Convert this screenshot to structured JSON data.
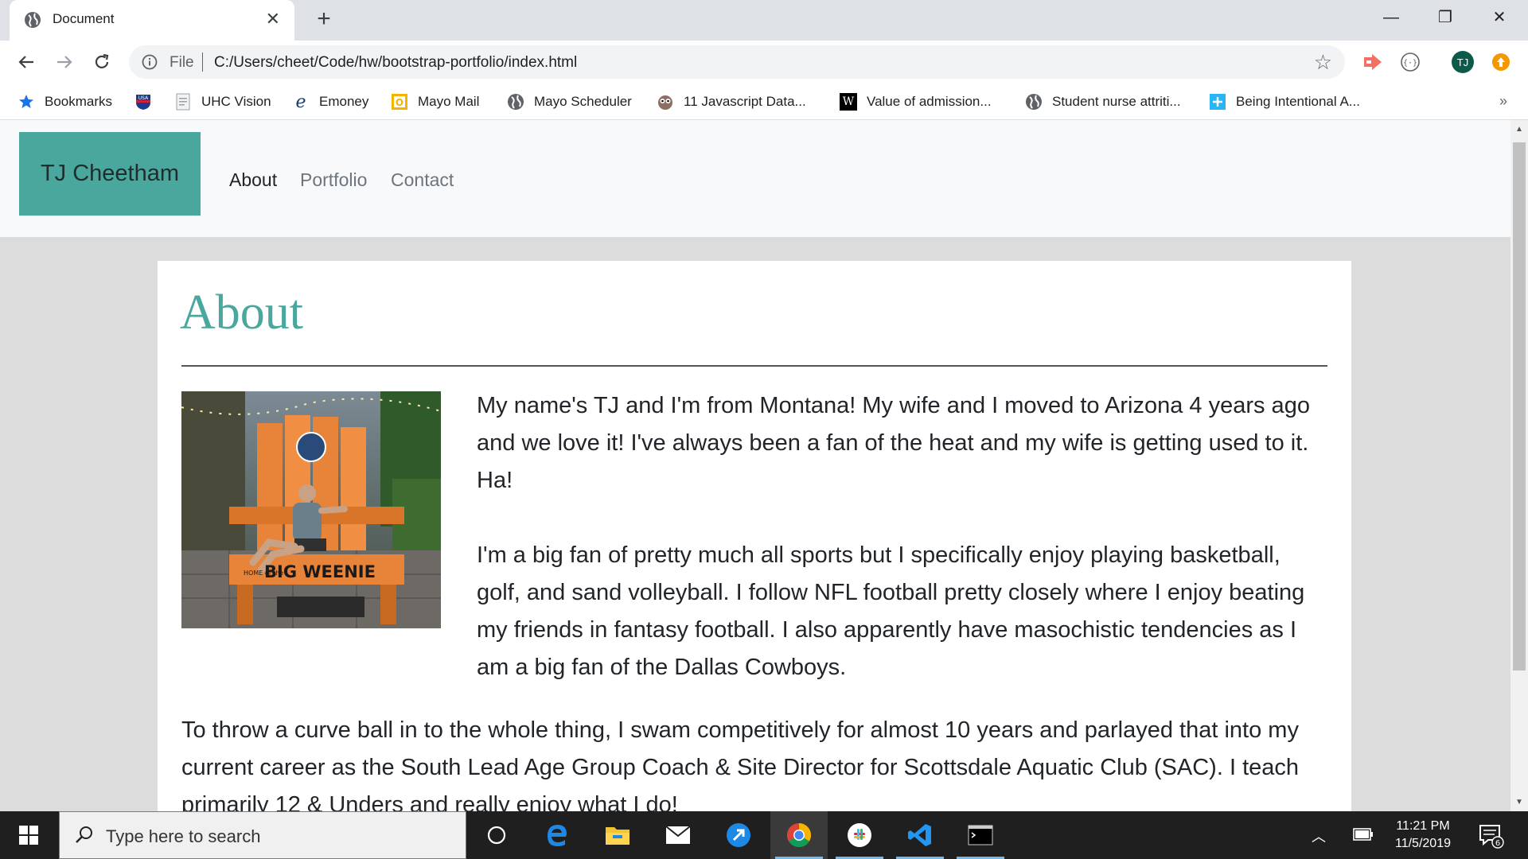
{
  "browser": {
    "tab_title": "Document",
    "url_scheme": "File",
    "url": "C:/Users/cheet/Code/hw/bootstrap-portfolio/index.html",
    "avatar_initials": "TJ",
    "bookmarks": [
      {
        "label": "Bookmarks",
        "icon": "star-icon"
      },
      {
        "label": "",
        "icon": "usa-flag-icon"
      },
      {
        "label": "UHC Vision",
        "icon": "document-icon"
      },
      {
        "label": "Emoney",
        "icon": "e-logo-icon"
      },
      {
        "label": "Mayo Mail",
        "icon": "outlook-icon"
      },
      {
        "label": "Mayo Scheduler",
        "icon": "globe-icon"
      },
      {
        "label": "11 Javascript Data...",
        "icon": "owl-icon"
      },
      {
        "label": "Value of admission...",
        "icon": "w-logo-icon"
      },
      {
        "label": "Student nurse attriti...",
        "icon": "globe-icon"
      },
      {
        "label": "Being Intentional A...",
        "icon": "plus-tile-icon"
      }
    ],
    "more_bookmarks": "»"
  },
  "site": {
    "brand": "TJ Cheetham",
    "nav": [
      "About",
      "Portfolio",
      "Contact"
    ]
  },
  "about": {
    "heading": "About",
    "photo_alt": "Man sitting in giant orange chair",
    "photo_sign_small": "HOME of the",
    "photo_sign": "BIG WEENIE",
    "paragraphs": [
      "My name's TJ and I'm from Montana! My wife and I moved to Arizona 4 years ago and we love it! I've always been a fan of the heat and my wife is getting used to it. Ha!",
      "I'm a big fan of pretty much all sports but I specifically enjoy playing basketball, golf, and sand volleyball. I follow NFL football pretty closely where I enjoy beating my friends in fantasy football. I also apparently have masochistic tendencies as I am a big fan of the Dallas Cowboys.",
      "To throw a curve ball in to the whole thing, I swam competitively for almost 10 years and parlayed that into my current career as the South Lead Age Group Coach & Site Director for Scottsdale Aquatic Club (SAC). I teach primarily 12 & Unders and really enjoy what I do!"
    ]
  },
  "taskbar": {
    "search_placeholder": "Type here to search",
    "time": "11:21 PM",
    "date": "11/5/2019",
    "notification_count": "6"
  },
  "colors": {
    "accent": "#4aa79e",
    "taskbar": "#1f1f1f"
  }
}
